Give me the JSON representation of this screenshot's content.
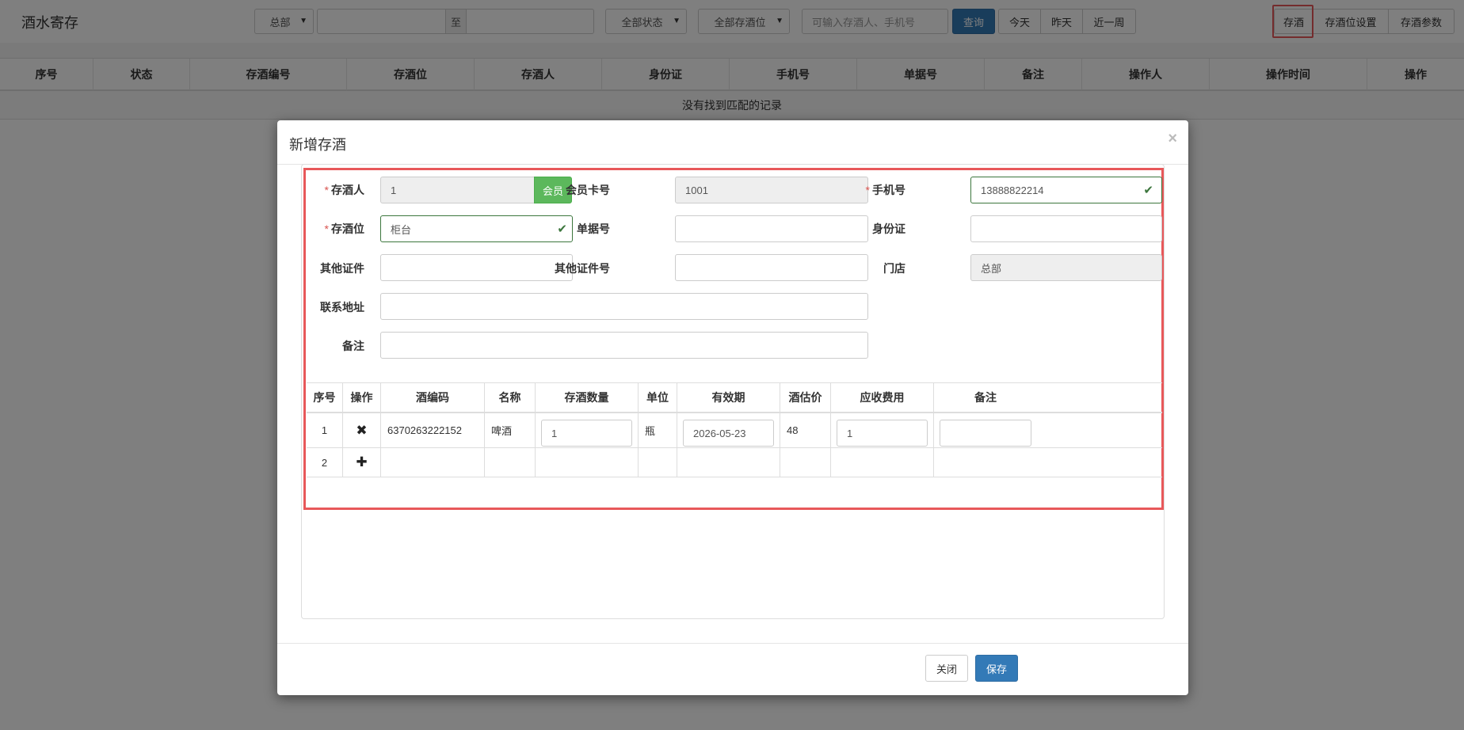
{
  "app": {
    "title": "酒水寄存"
  },
  "toolbar": {
    "store_select": "总部",
    "date_separator": "至",
    "status_select": "全部状态",
    "location_select": "全部存酒位",
    "search_placeholder": "可输入存酒人、手机号",
    "query_label": "查询",
    "today_label": "今天",
    "yesterday_label": "昨天",
    "week_label": "近一周",
    "store_wine_label": "存酒",
    "location_settings_label": "存酒位设置",
    "params_label": "存酒参数"
  },
  "grid": {
    "columns": [
      "序号",
      "状态",
      "存酒编号",
      "存酒位",
      "存酒人",
      "身份证",
      "手机号",
      "单据号",
      "备注",
      "操作人",
      "操作时间",
      "操作"
    ],
    "empty_text": "没有找到匹配的记录"
  },
  "modal": {
    "title": "新增存酒",
    "close_glyph": "×",
    "form": {
      "depositor_label": "存酒人",
      "depositor_value": "1",
      "member_button": "会员",
      "card_label": "会员卡号",
      "card_value": "1001",
      "phone_label": "手机号",
      "phone_value": "13888822214",
      "location_label": "存酒位",
      "location_value": "柜台",
      "receipt_label": "单据号",
      "receipt_value": "",
      "id_label": "身份证",
      "id_value": "",
      "other_id_label": "其他证件",
      "other_id_value": "",
      "other_id_no_label": "其他证件号",
      "other_id_no_value": "",
      "store_label": "门店",
      "store_value": "总部",
      "address_label": "联系地址",
      "address_value": "",
      "remark_label": "备注",
      "remark_value": ""
    },
    "items": {
      "columns": [
        "序号",
        "操作",
        "酒编码",
        "名称",
        "存酒数量",
        "单位",
        "有效期",
        "酒估价",
        "应收费用",
        "备注"
      ],
      "rows": [
        {
          "no": "1",
          "op_icon": "remove-icon",
          "op_glyph": "✖",
          "code": "6370263222152",
          "name": "啤酒",
          "qty": "1",
          "unit": "瓶",
          "expiry": "2026-05-23",
          "price": "48",
          "fee": "1",
          "remark": ""
        },
        {
          "no": "2",
          "op_icon": "plus-icon",
          "op_glyph": "✚"
        }
      ]
    },
    "footer": {
      "close_label": "关闭",
      "save_label": "保存"
    }
  },
  "colors": {
    "primary": "#337ab7",
    "success": "#5cb85c",
    "highlight": "#e8585a",
    "valid": "#3c763d",
    "required": "#d9534f"
  }
}
